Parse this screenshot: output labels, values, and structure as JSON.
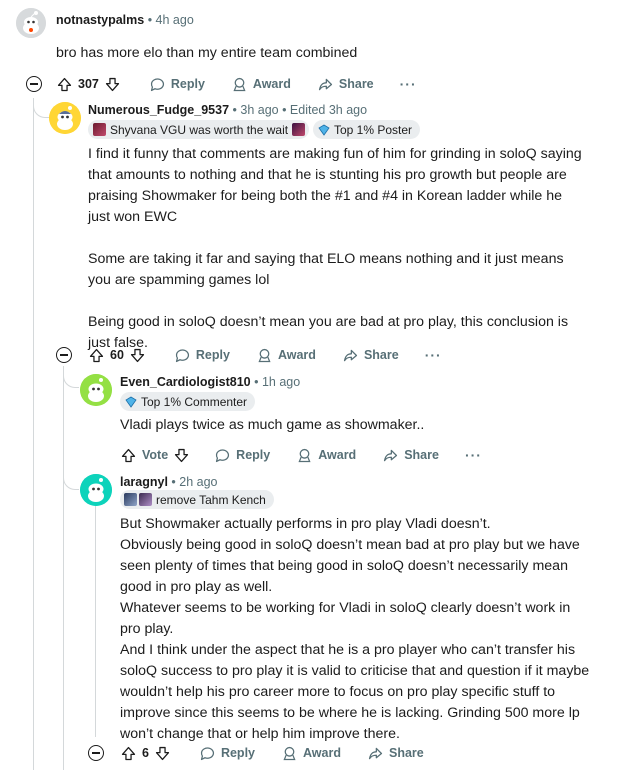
{
  "comments": [
    {
      "username": "notnastypalms",
      "time": "• 4h ago",
      "body": [
        "bro has more elo than my entire team combined"
      ],
      "votes": "307",
      "reply": "Reply",
      "award": "Award",
      "share": "Share",
      "more": "···"
    },
    {
      "username": "Numerous_Fudge_9537",
      "time": "• 3h ago • Edited 3h ago",
      "flair": "Shyvana VGU was worth the wait",
      "badge": "Top 1% Poster",
      "body": [
        "I find it funny that comments are making fun of him for grinding in soloQ saying that amounts to nothing and that he is stunting his pro growth but people are praising Showmaker for being both the #1 and #4 in Korean ladder while he just won EWC",
        "Some are taking it far and saying that ELO means nothing and it just means you are spamming games lol",
        "Being good in soloQ doesn’t mean you are bad at pro play, this conclusion is just false."
      ],
      "votes": "60",
      "reply": "Reply",
      "award": "Award",
      "share": "Share",
      "more": "···"
    },
    {
      "username": "Even_Cardiologist810",
      "time": "• 1h ago",
      "badge": "Top 1% Commenter",
      "body": [
        "Vladi plays twice as much game as showmaker.."
      ],
      "votes": "Vote",
      "reply": "Reply",
      "award": "Award",
      "share": "Share",
      "more": "···"
    },
    {
      "username": "laragnyl",
      "time": "• 2h ago",
      "flair": "remove Tahm Kench",
      "body": [
        "But Showmaker actually performs in pro play Vladi doesn’t.",
        "Obviously being good in soloQ doesn’t mean bad at pro play but we have seen plenty of times that being good in soloQ doesn’t necessarily mean good in pro play as well.",
        "Whatever seems to be working for Vladi in soloQ clearly doesn’t work in pro play.",
        "And I think under the aspect that he is a pro player who can’t transfer his soloQ success to pro play it is valid to criticise that and question if it maybe wouldn’t help his pro career more to focus on pro play specific stuff to improve since this seems to be where he is lacking. Grinding 500 more lp won’t change that or help him improve there."
      ],
      "votes": "6",
      "reply": "Reply",
      "award": "Award",
      "share": "Share",
      "more": "···"
    }
  ],
  "colors": {
    "avatar1": "#d7dadc",
    "avatar2": "#ffd635",
    "avatar3": "#94e044",
    "avatar4": "#0dd3bb",
    "thread": "#d4d8da",
    "meta": "#576f76"
  }
}
